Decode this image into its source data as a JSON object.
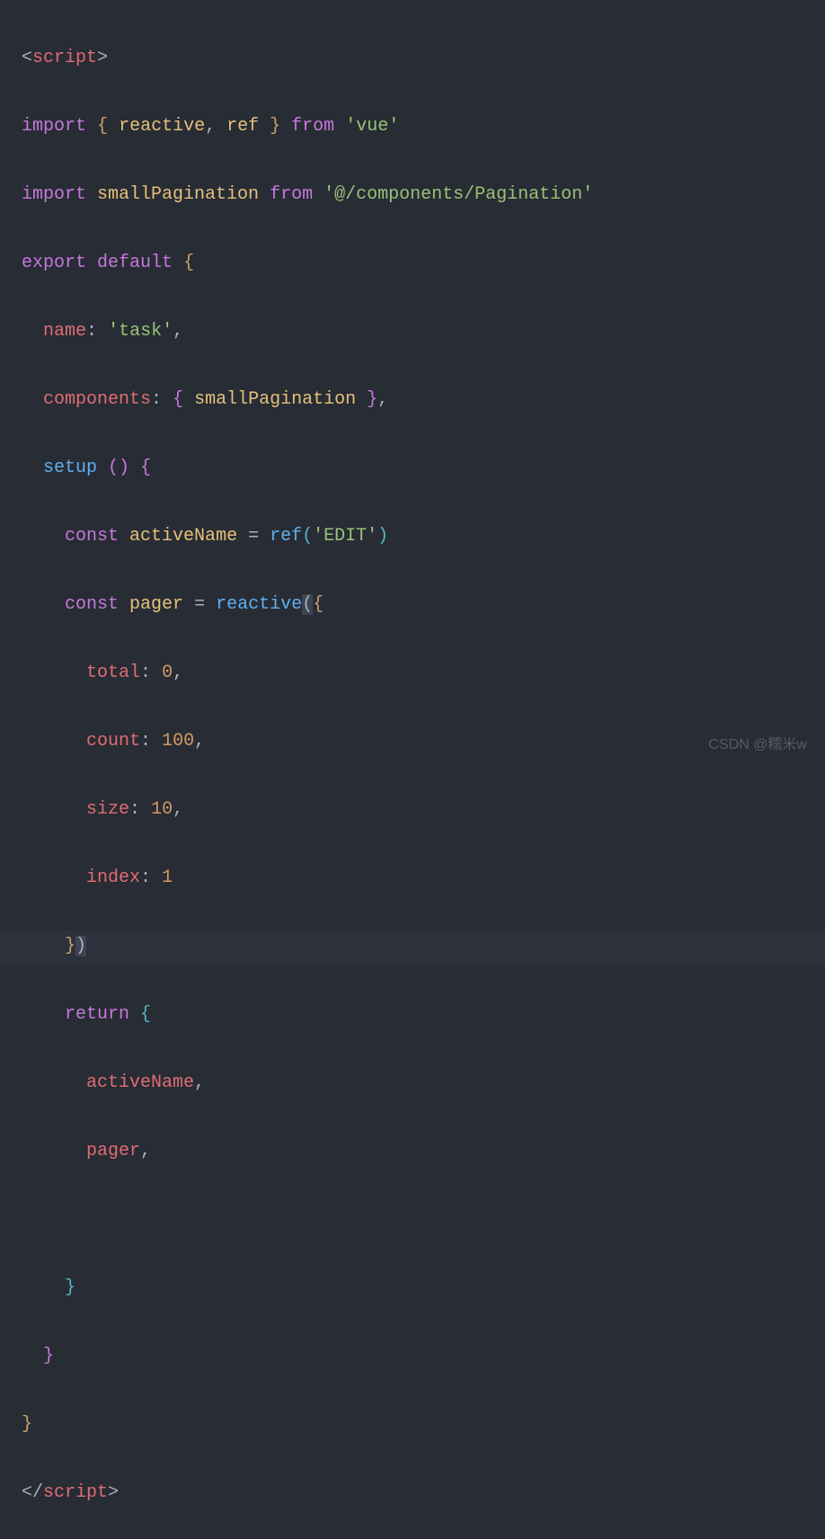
{
  "code": {
    "l1_open": "<",
    "l1_tag": "script",
    "l1_close": ">",
    "l2_import": "import",
    "l2_brace_open": "{",
    "l2_reactive": "reactive",
    "l2_comma": ",",
    "l2_ref": "ref",
    "l2_brace_close": "}",
    "l2_from": "from",
    "l2_vue": "'vue'",
    "l3_import": "import",
    "l3_name": "smallPagination",
    "l3_from": "from",
    "l3_path": "'@/components/Pagination'",
    "l4_export": "export",
    "l4_default": "default",
    "l4_brace": "{",
    "l5_name": "name",
    "l5_colon": ":",
    "l5_value": "'task'",
    "l5_comma": ",",
    "l6_components": "components",
    "l6_colon": ":",
    "l6_brace_open": "{",
    "l6_value": "smallPagination",
    "l6_brace_close": "}",
    "l6_comma": ",",
    "l7_setup": "setup",
    "l7_parens": "()",
    "l7_brace": "{",
    "l8_const": "const",
    "l8_var": "activeName",
    "l8_eq": "=",
    "l8_ref": "ref",
    "l8_paren_open": "(",
    "l8_arg": "'EDIT'",
    "l8_paren_close": ")",
    "l9_const": "const",
    "l9_var": "pager",
    "l9_eq": "=",
    "l9_reactive": "reactive",
    "l9_paren_open": "(",
    "l9_brace": "{",
    "l10_prop": "total",
    "l10_colon": ":",
    "l10_val": "0",
    "l10_comma": ",",
    "l11_prop": "count",
    "l11_colon": ":",
    "l11_val": "100",
    "l11_comma": ",",
    "l12_prop": "size",
    "l12_colon": ":",
    "l12_val": "10",
    "l12_comma": ",",
    "l13_prop": "index",
    "l13_colon": ":",
    "l13_val": "1",
    "l14_brace": "}",
    "l14_paren": ")",
    "l15_return": "return",
    "l15_brace": "{",
    "l16_prop": "activeName",
    "l16_comma": ",",
    "l17_prop": "pager",
    "l17_comma": ",",
    "l19_brace": "}",
    "l20_brace": "}",
    "l21_brace": "}",
    "l22_open": "</",
    "l22_tag": "script",
    "l22_close": ">"
  },
  "watermark": "CSDN @糯米w"
}
